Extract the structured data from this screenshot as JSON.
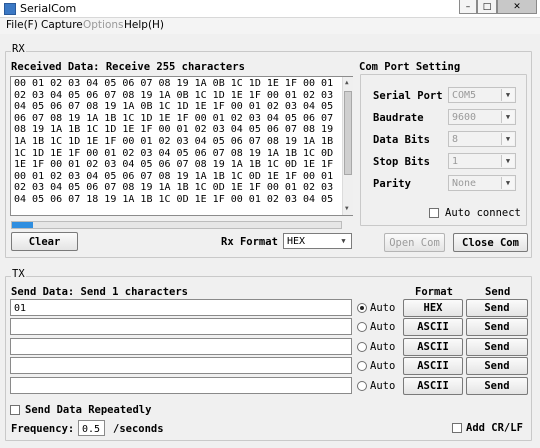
{
  "window": {
    "title": "SerialCom",
    "min_glyph": "–",
    "max_glyph": "□",
    "close_glyph": "✕"
  },
  "menu": {
    "file": "File(F)",
    "capture": "Capture",
    "options": "Options",
    "help": "Help(H)"
  },
  "rx": {
    "group_label": "RX",
    "received_label": "Received Data: Receive 255 characters",
    "text": "00 01 02 03 04 05 06 07 08 19 1A 0B 1C 1D 1E 1F 00 01\n02 03 04 05 06 07 08 19 1A 0B 1C 1D 1E 1F 00 01 02 03\n04 05 06 07 08 19 1A 0B 1C 1D 1E 1F 00 01 02 03 04 05\n06 07 08 19 1A 1B 1C 1D 1E 1F 00 01 02 03 04 05 06 07\n08 19 1A 1B 1C 1D 1E 1F 00 01 02 03 04 05 06 07 08 19\n1A 1B 1C 1D 1E 1F 00 01 02 03 04 05 06 07 08 19 1A 1B\n1C 1D 1E 1F 00 01 02 03 04 05 06 07 08 19 1A 1B 1C 0D\n1E 1F 00 01 02 03 04 05 06 07 08 19 1A 1B 1C 0D 1E 1F\n00 01 02 03 04 05 06 07 08 19 1A 1B 1C 0D 1E 1F 00 01\n02 03 04 05 06 07 08 19 1A 1B 1C 0D 1E 1F 00 01 02 03\n04 05 06 07 18 19 1A 1B 1C 0D 1E 1F 00 01 02 03 04 05",
    "progress_fraction": 0.065,
    "clear_label": "Clear",
    "format_label": "Rx Format",
    "format_value": "HEX"
  },
  "port": {
    "group_label": "Com Port Setting",
    "serial_port_label": "Serial Port",
    "serial_port_value": "COM5",
    "baudrate_label": "Baudrate",
    "baudrate_value": "9600",
    "databits_label": "Data Bits",
    "databits_value": "8",
    "stopbits_label": "Stop Bits",
    "stopbits_value": "1",
    "parity_label": "Parity",
    "parity_value": "None",
    "auto_connect_label": "Auto connect",
    "open_label": "Open Com",
    "close_label": "Close Com"
  },
  "tx": {
    "group_label": "TX",
    "send_label": "Send Data: Send 1 characters",
    "format_header": "Format",
    "send_header": "Send",
    "rows": [
      {
        "value": "01",
        "auto": "Auto",
        "format": "HEX",
        "send": "Send",
        "selected": true
      },
      {
        "value": "",
        "auto": "Auto",
        "format": "ASCII",
        "send": "Send",
        "selected": false
      },
      {
        "value": "",
        "auto": "Auto",
        "format": "ASCII",
        "send": "Send",
        "selected": false
      },
      {
        "value": "",
        "auto": "Auto",
        "format": "ASCII",
        "send": "Send",
        "selected": false
      },
      {
        "value": "",
        "auto": "Auto",
        "format": "ASCII",
        "send": "Send",
        "selected": false
      }
    ],
    "repeat_label": "Send Data Repeatedly",
    "frequency_label": "Frequency:",
    "frequency_value": "0.5",
    "seconds_label": "/seconds",
    "crlf_label": "Add CR/LF"
  }
}
